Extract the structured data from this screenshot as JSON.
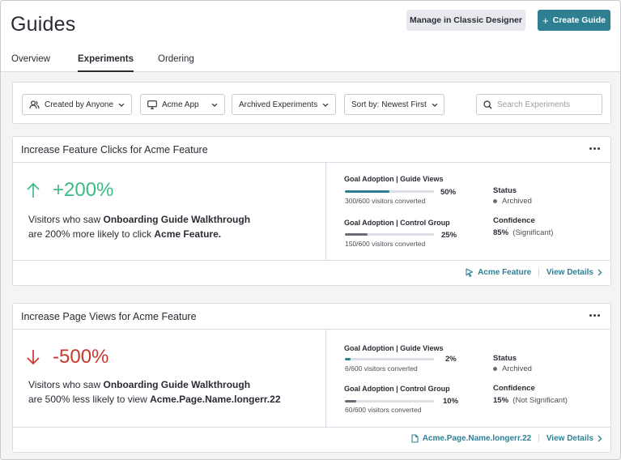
{
  "header": {
    "title": "Guides",
    "classic_button": "Manage in Classic Designer",
    "create_button": "Create Guide",
    "create_button_icon": "plus-icon"
  },
  "tabs": [
    {
      "label": "Overview",
      "active": false
    },
    {
      "label": "Experiments",
      "active": true
    },
    {
      "label": "Ordering",
      "active": false
    }
  ],
  "filters": {
    "created_by": "Created by Anyone",
    "app": "Acme App",
    "archived": "Archived Experiments",
    "sort": "Sort by: Newest First",
    "search_placeholder": "Search Experiments"
  },
  "colors": {
    "accent": "#2f7f93",
    "positive": "#3dbb86",
    "negative": "#c8372d",
    "control_bar": "#6a6c75"
  },
  "experiments": [
    {
      "title": "Increase Feature Clicks for Acme Feature",
      "direction": "up",
      "lift": "+200%",
      "desc_pre": "Visitors who saw ",
      "desc_guide": "Onboarding Guide Walkthrough",
      "desc_mid": "are 200% more likely to click ",
      "desc_target": "Acme Feature.",
      "guide_metric": {
        "label": "Goal Adoption | Guide Views",
        "pct": "50%",
        "fraction": 0.5,
        "sub": "300/600 visitors converted"
      },
      "control_metric": {
        "label": "Goal Adoption | Control Group",
        "pct": "25%",
        "fraction": 0.25,
        "sub": "150/600 visitors converted"
      },
      "status_label": "Status",
      "status": "Archived",
      "confidence_label": "Confidence",
      "confidence_value": "85%",
      "confidence_note": "(Significant)",
      "target_link": "Acme Feature",
      "target_icon": "cursor-icon",
      "details_link": "View Details"
    },
    {
      "title": "Increase Page Views for Acme Feature",
      "direction": "down",
      "lift": "-500%",
      "desc_pre": "Visitors who saw ",
      "desc_guide": "Onboarding Guide Walkthrough",
      "desc_mid": "are 500% less likely to view ",
      "desc_target": "Acme.Page.Name.longerr.22",
      "guide_metric": {
        "label": "Goal Adoption | Guide Views",
        "pct": "2%",
        "fraction": 0.06,
        "sub": "6/600 visitors converted"
      },
      "control_metric": {
        "label": "Goal Adoption | Control Group",
        "pct": "10%",
        "fraction": 0.13,
        "sub": "60/600 visitors converted"
      },
      "status_label": "Status",
      "status": "Archived",
      "confidence_label": "Confidence",
      "confidence_value": "15%",
      "confidence_note": "(Not Significant)",
      "target_link": "Acme.Page.Name.longerr.22",
      "target_icon": "page-icon",
      "details_link": "View Details"
    }
  ]
}
